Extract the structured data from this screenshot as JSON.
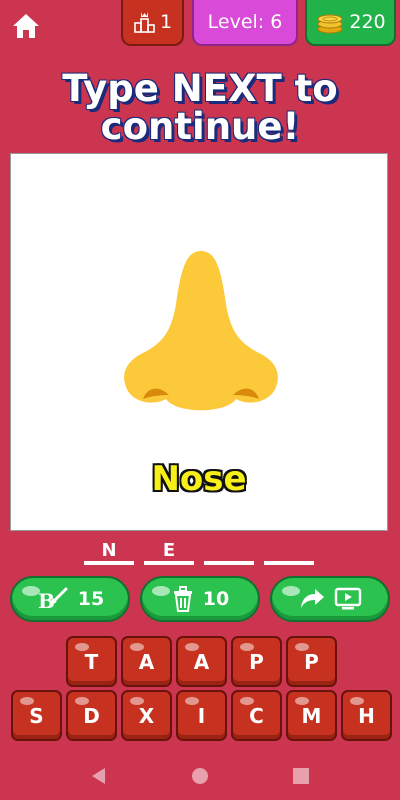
{
  "topbar": {
    "rank_count": "1",
    "level_label": "Level: 6",
    "coins": "220"
  },
  "title": {
    "line1": "Type NEXT to",
    "line2": "continue!"
  },
  "card": {
    "word": "Nose",
    "image_icon": "nose-icon"
  },
  "answer_slots": [
    "N",
    "E",
    "",
    ""
  ],
  "hint_buttons": {
    "reveal_cost": "15",
    "remove_cost": "10"
  },
  "keyboard": {
    "row1": [
      "T",
      "A",
      "A",
      "P",
      "P"
    ],
    "row2": [
      "S",
      "D",
      "X",
      "I",
      "C",
      "M",
      "H"
    ]
  },
  "colors": {
    "background": "#cc3550",
    "key": "#c7311f",
    "green": "#2bc24f",
    "level": "#d94ad9",
    "nose": "#fcc93a"
  }
}
